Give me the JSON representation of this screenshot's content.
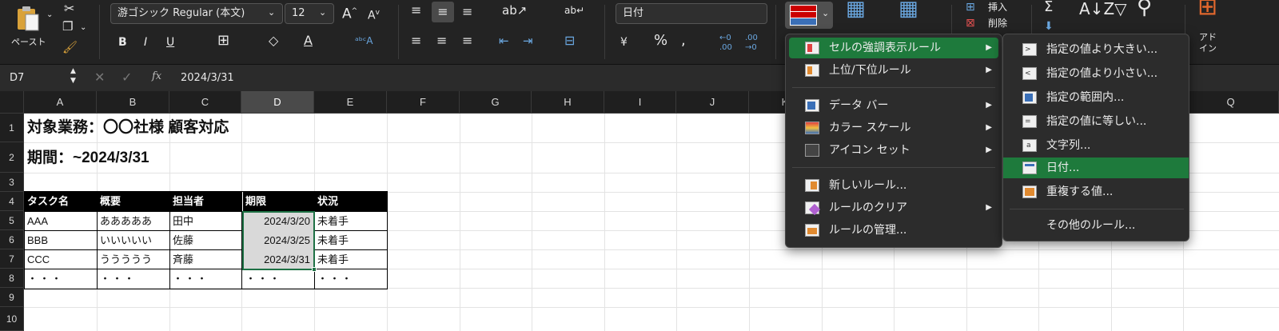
{
  "ribbon": {
    "paste_label": "ペースト",
    "font_name": "游ゴシック Regular (本文)",
    "font_size": "12",
    "bold": "B",
    "italic": "I",
    "underline": "U",
    "number_format": "日付",
    "percent": "%",
    "insert_label": "挿入",
    "delete_label": "削除",
    "addin_label": "アド\nイン"
  },
  "formula_bar": {
    "cell_ref": "D7",
    "fx": "fx",
    "value": "2024/3/31"
  },
  "columns": [
    "A",
    "B",
    "C",
    "D",
    "E",
    "F",
    "G",
    "H",
    "I",
    "J",
    "K",
    "L",
    "M",
    "N",
    "O",
    "P",
    "Q"
  ],
  "rows": [
    "1",
    "2",
    "3",
    "4",
    "5",
    "6",
    "7",
    "8",
    "9",
    "10"
  ],
  "sheet": {
    "a1": "対象業務：〇〇社様 顧客対応",
    "a2": "期間：~2024/3/31",
    "headers": [
      "タスク名",
      "概要",
      "担当者",
      "期限",
      "状況"
    ],
    "data": [
      [
        "AAA",
        "あああああ",
        "田中",
        "2024/3/20",
        "未着手"
      ],
      [
        "BBB",
        "いいいいい",
        "佐藤",
        "2024/3/25",
        "未着手"
      ],
      [
        "CCC",
        "ううううう",
        "斉藤",
        "2024/3/31",
        "未着手"
      ],
      [
        "・・・",
        "・・・",
        "・・・",
        "・・・",
        "・・・"
      ]
    ]
  },
  "menu1": {
    "items": [
      "セルの強調表示ルール",
      "上位/下位ルール",
      "データ バー",
      "カラー スケール",
      "アイコン セット",
      "新しいルール...",
      "ルールのクリア",
      "ルールの管理..."
    ]
  },
  "menu2": {
    "items": [
      "指定の値より大きい...",
      "指定の値より小さい...",
      "指定の範囲内...",
      "指定の値に等しい...",
      "文字列...",
      "日付...",
      "重複する値...",
      "その他のルール..."
    ]
  },
  "colors": {
    "ribbon_bg": "#232323",
    "highlight": "#1e7a3c",
    "selection_border": "#1e7145",
    "selected_fill": "#d9d9d9"
  }
}
